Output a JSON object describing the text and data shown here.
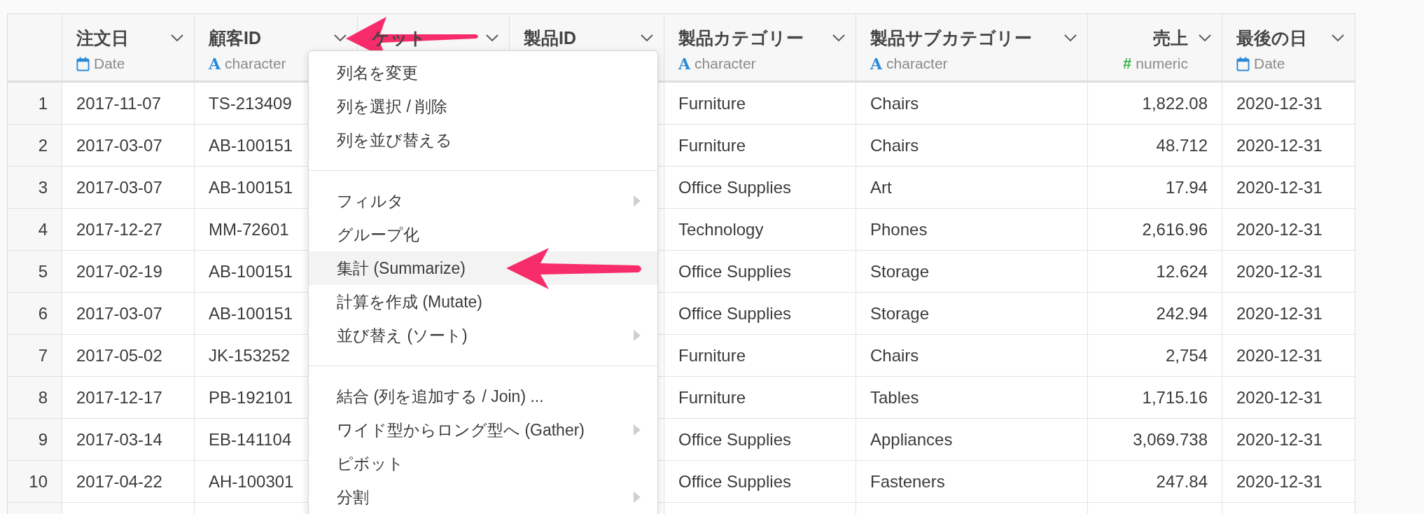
{
  "table": {
    "columns": [
      {
        "name": "注文日",
        "kind": "date",
        "type_label": "Date"
      },
      {
        "name": "顧客ID",
        "kind": "character",
        "type_icon": "A",
        "type_label": "character"
      },
      {
        "name": "ケット",
        "kind": "hidden"
      },
      {
        "name": "製品ID",
        "kind": "hidden"
      },
      {
        "name": "製品カテゴリー",
        "kind": "character",
        "type_icon": "A",
        "type_label": "character"
      },
      {
        "name": "製品サブカテゴリー",
        "kind": "character",
        "type_icon": "A",
        "type_label": "character"
      },
      {
        "name": "売上",
        "kind": "numeric",
        "type_icon": "#",
        "type_label": "numeric"
      },
      {
        "name": "最後の日",
        "kind": "date",
        "type_label": "Date"
      }
    ],
    "rows": [
      {
        "number": "1",
        "cells": [
          "2017-11-07",
          "TS-213409",
          "",
          "",
          "Furniture",
          "Chairs",
          "1,822.08",
          "2020-12-31"
        ]
      },
      {
        "number": "2",
        "cells": [
          "2017-03-07",
          "AB-100151",
          "",
          "",
          "Furniture",
          "Chairs",
          "48.712",
          "2020-12-31"
        ]
      },
      {
        "number": "3",
        "cells": [
          "2017-03-07",
          "AB-100151",
          "",
          "",
          "Office Supplies",
          "Art",
          "17.94",
          "2020-12-31"
        ]
      },
      {
        "number": "4",
        "cells": [
          "2017-12-27",
          "MM-72601",
          "",
          "",
          "Technology",
          "Phones",
          "2,616.96",
          "2020-12-31"
        ]
      },
      {
        "number": "5",
        "cells": [
          "2017-02-19",
          "AB-100151",
          "",
          "",
          "Office Supplies",
          "Storage",
          "12.624",
          "2020-12-31"
        ]
      },
      {
        "number": "6",
        "cells": [
          "2017-03-07",
          "AB-100151",
          "",
          "",
          "Office Supplies",
          "Storage",
          "242.94",
          "2020-12-31"
        ]
      },
      {
        "number": "7",
        "cells": [
          "2017-05-02",
          "JK-153252",
          "",
          "",
          "Furniture",
          "Chairs",
          "2,754",
          "2020-12-31"
        ]
      },
      {
        "number": "8",
        "cells": [
          "2017-12-17",
          "PB-192101",
          "",
          "",
          "Furniture",
          "Tables",
          "1,715.16",
          "2020-12-31"
        ]
      },
      {
        "number": "9",
        "cells": [
          "2017-03-14",
          "EB-141104",
          "",
          "",
          "Office Supplies",
          "Appliances",
          "3,069.738",
          "2020-12-31"
        ]
      },
      {
        "number": "10",
        "cells": [
          "2017-04-22",
          "AH-100301",
          "",
          "",
          "Office Supplies",
          "Fasteners",
          "247.84",
          "2020-12-31"
        ]
      }
    ]
  },
  "column_menu": {
    "groups": [
      [
        {
          "label": "列名を変更",
          "selected": false,
          "submenu": false
        },
        {
          "label": "列を選択 / 削除",
          "selected": false,
          "submenu": false
        },
        {
          "label": "列を並び替える",
          "selected": false,
          "submenu": false
        }
      ],
      [
        {
          "label": "フィルタ",
          "selected": false,
          "submenu": true
        },
        {
          "label": "グループ化",
          "selected": false,
          "submenu": false
        },
        {
          "label": "集計 (Summarize)",
          "selected": true,
          "submenu": false
        },
        {
          "label": "計算を作成 (Mutate)",
          "selected": false,
          "submenu": false
        },
        {
          "label": "並び替え (ソート)",
          "selected": false,
          "submenu": true
        }
      ],
      [
        {
          "label": "結合 (列を追加する / Join) ...",
          "selected": false,
          "submenu": false
        },
        {
          "label": "ワイド型からロング型へ (Gather)",
          "selected": false,
          "submenu": true
        },
        {
          "label": "ピボット",
          "selected": false,
          "submenu": false
        },
        {
          "label": "分割",
          "selected": false,
          "submenu": true
        }
      ]
    ]
  }
}
